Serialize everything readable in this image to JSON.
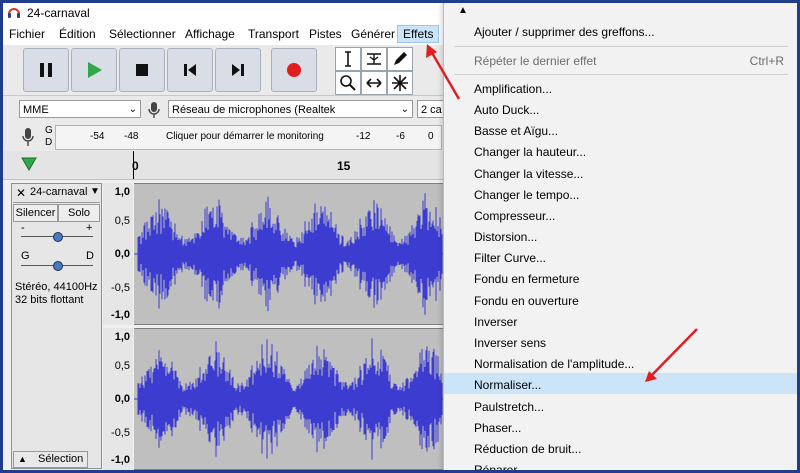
{
  "window": {
    "title": "24-carnaval"
  },
  "menubar": {
    "items": [
      "Fichier",
      "Édition",
      "Sélectionner",
      "Affichage",
      "Transport",
      "Pistes",
      "Générer",
      "Effets"
    ]
  },
  "devices": {
    "host": "MME",
    "mic": "Réseau de microphones (Realtek",
    "channels": "2 ca"
  },
  "meter": {
    "left_label": "G",
    "right_label": "D",
    "ticks": [
      "-54",
      "-48",
      "-12",
      "-6",
      "0"
    ],
    "prompt": "Cliquer pour démarrer le monitoring"
  },
  "ruler": {
    "ticks": [
      "0",
      "15"
    ]
  },
  "track": {
    "name": "24-carnaval",
    "mute_label": "Silencer",
    "solo_label": "Solo",
    "gain_minus": "-",
    "gain_plus": "+",
    "pan_left": "G",
    "pan_right": "D",
    "info_line1": "Stéréo, 44100Hz",
    "info_line2": "32 bits flottant",
    "select_label": "Sélection",
    "scale_top": [
      "1,0",
      "0,5",
      "0,0",
      "-0,5",
      "-1,0"
    ],
    "scale_bottom": [
      "1,0",
      "0,5",
      "0,0",
      "-0,5",
      "-1,0"
    ]
  },
  "effects_menu": {
    "top_items": [
      "Ajouter / supprimer des greffons..."
    ],
    "repeat_item": {
      "label": "Répéter le dernier effet",
      "shortcut": "Ctrl+R"
    },
    "items": [
      "Amplification...",
      "Auto Duck...",
      "Basse et Aïgu...",
      "Changer la hauteur...",
      "Changer la vitesse...",
      "Changer le tempo...",
      "Compresseur...",
      "Distorsion...",
      "Filter Curve...",
      "Fondu en fermeture",
      "Fondu en ouverture",
      "Inverser",
      "Inverser sens",
      "Normalisation de l'amplitude...",
      "Normaliser...",
      "Paulstretch...",
      "Phaser...",
      "Réduction de bruit...",
      "Réparer"
    ],
    "highlighted_item": "Normaliser..."
  },
  "colors": {
    "waveform": "#3c3cd0",
    "play": "#2ea84a",
    "record": "#e02020",
    "annotation_arrow": "#e02020",
    "highlight": "#cce4f7",
    "frame": "#1f3d8a"
  }
}
